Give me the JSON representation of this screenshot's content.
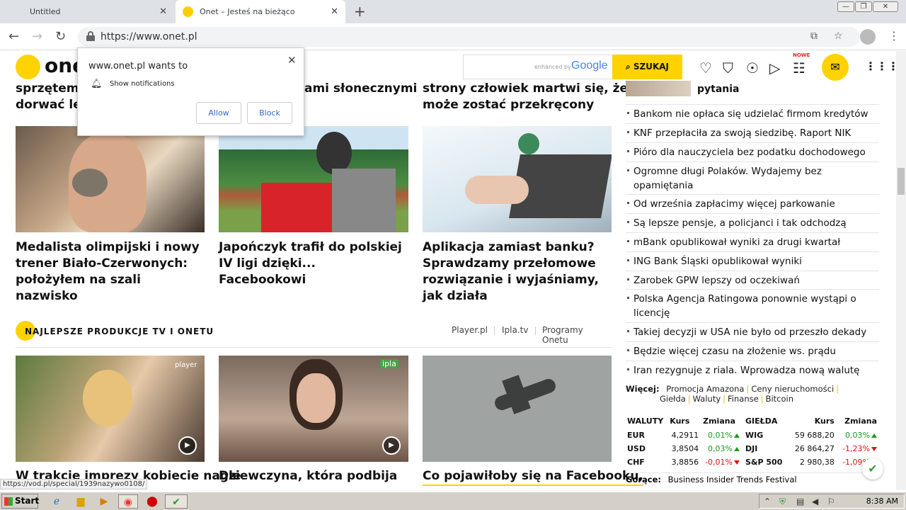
{
  "browser": {
    "tabs": [
      {
        "title": "Untitled",
        "active": false
      },
      {
        "title": "Onet – Jesteś na bieżąco",
        "active": true
      }
    ],
    "url": "https://www.onet.pl",
    "status_url": "https://vod.pl/special/1939nazywo0108/"
  },
  "popup": {
    "title": "www.onet.pl wants to",
    "permission": "Show notifications",
    "allow": "Allow",
    "block": "Block"
  },
  "header": {
    "logo": "onet",
    "search_enhanced": "enhanced by",
    "search_google": "Google",
    "search_button": "SZUKAJ",
    "new_badge": "NOWE"
  },
  "top_fragments": {
    "a": "sprzętem n",
    "b": "dorwać lek",
    "c": "ami słonecznymi",
    "d": "strony człowiek martwi się, że",
    "e": "może zostać przekręcony"
  },
  "articles": [
    {
      "title": "Medalista olimpijski i nowy trener Biało-Czerwonych: położyłem na szali nazwisko"
    },
    {
      "title": "Japończyk trafił do polskiej IV ligi dzięki... Facebookowi"
    },
    {
      "title": "Aplikacja zamiast banku? Sprawdzamy przełomowe rozwiązanie i wyjaśniamy, jak działa"
    }
  ],
  "section": {
    "title": "NAJLEPSZE PRODUKCJE TV I ONETU",
    "links": [
      "Player.pl",
      "Ipla.tv",
      "Programy Onetu"
    ]
  },
  "videos": [
    {
      "title": "W trakcie imprezy kobiecie nagle",
      "badge": "player"
    },
    {
      "title": "Dziewczyna, która podbija",
      "badge": "ipla"
    },
    {
      "title": "Co pojawiłoby się na Facebooku,",
      "badge": ""
    }
  ],
  "right": {
    "top_fragment": "pytania",
    "links": [
      "Bankom nie opłaca się udzielać firmom kredytów",
      "KNF przepłaciła za swoją siedzibę. Raport NIK",
      "Pióro dla nauczyciela bez podatku dochodowego",
      "Ogromne długi Polaków. Wydajemy bez opamiętania",
      "Od września zapłacimy więcej parkowanie",
      "Są lepsze pensje, a policjanci i tak odchodzą",
      "mBank opublikował wyniki za drugi kwartał",
      "ING Bank Śląski opublikował wyniki",
      "Zarobek GPW lepszy od oczekiwań",
      "Polska Agencja Ratingowa ponownie wystąpi o licencję",
      "Takiej decyzji w USA nie było od przeszło dekady",
      "Będzie więcej czasu na złożenie ws. prądu",
      "Iran rezygnuje z riala. Wprowadza nową walutę"
    ],
    "more_label": "Więcej:",
    "more_links": [
      "Promocja Amazona",
      "Ceny nieruchomości",
      "Giełda",
      "Waluty",
      "Finanse",
      "Bitcoin"
    ],
    "currency_header": [
      "WALUTY",
      "Kurs",
      "Zmiana"
    ],
    "currencies": [
      {
        "name": "EUR",
        "rate": "4,2911",
        "change": "0,01%",
        "dir": "up"
      },
      {
        "name": "USD",
        "rate": "3,8504",
        "change": "0,03%",
        "dir": "up"
      },
      {
        "name": "CHF",
        "rate": "3,8856",
        "change": "-0,01%",
        "dir": "down"
      }
    ],
    "stock_header": [
      "GIEŁDA",
      "Kurs",
      "Zmiana"
    ],
    "stocks": [
      {
        "name": "WIG",
        "rate": "59 688,20",
        "change": "0,03%",
        "dir": "up"
      },
      {
        "name": "DJI",
        "rate": "26 864,27",
        "change": "-1,23%",
        "dir": "down"
      },
      {
        "name": "S&P 500",
        "rate": "2 980,38",
        "change": "-1,09%",
        "dir": "down"
      }
    ],
    "hot_label": "Gorące:",
    "hot_link": "Business Insider Trends Festival"
  },
  "taskbar": {
    "start": "Start",
    "clock": "8:38 AM"
  },
  "colors": {
    "brand_yellow": "#ffd200",
    "up_green": "#1a9a1a",
    "down_red": "#dd1111"
  }
}
